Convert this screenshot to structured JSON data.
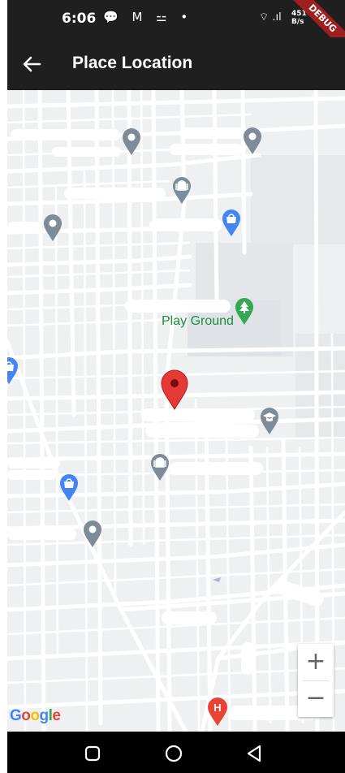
{
  "status_bar": {
    "time": "6:06",
    "left_icons": "💬 M ⚍ •",
    "right_icons": "⌔ .ıl",
    "net_speed_value": "451",
    "net_speed_unit": "B/s"
  },
  "debug_banner": "DEBUG",
  "app_bar": {
    "title": "Place Location",
    "back_icon": "arrow-left-icon"
  },
  "map": {
    "poi_label": "Play Ground",
    "poi_icon": "tree-icon",
    "selected_marker_color": "#e53935",
    "google_logo": {
      "G": "G",
      "o1": "o",
      "o2": "o",
      "g": "g",
      "l": "l",
      "e": "e"
    },
    "zoom_in": "+",
    "zoom_out": "−",
    "hospital_letter": "H"
  },
  "colors": {
    "bar_bg": "#1f1f1f",
    "map_bg": "#eef0f2",
    "road": "#ffffff",
    "pin_gray": "#7d8c98",
    "pin_blue": "#4285f4",
    "pin_green": "#34a853",
    "pin_red": "#ea4335"
  },
  "nav_bar": {
    "square_icon": "recents-square-icon",
    "circle_icon": "home-circle-icon",
    "triangle_icon": "back-triangle-icon"
  }
}
